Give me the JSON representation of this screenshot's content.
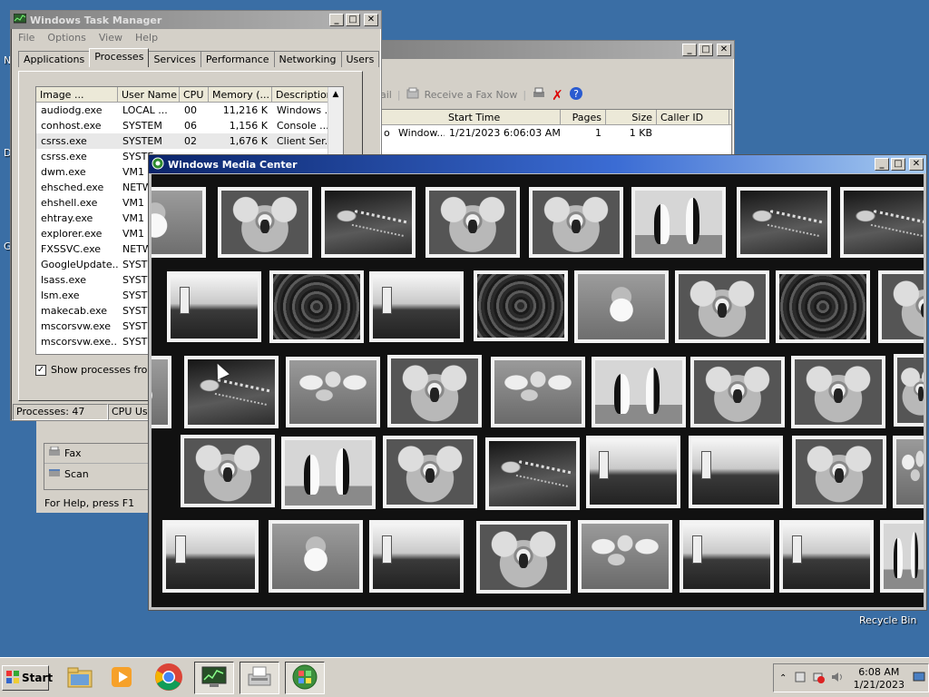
{
  "desktop": {
    "recycle_bin": "Recycle Bin",
    "edge_letters": [
      "N",
      "D",
      "G"
    ]
  },
  "task_manager": {
    "title": "Windows Task Manager",
    "menu": [
      "File",
      "Options",
      "View",
      "Help"
    ],
    "tabs": [
      "Applications",
      "Processes",
      "Services",
      "Performance",
      "Networking",
      "Users"
    ],
    "selected_tab": "Processes",
    "columns": [
      "Image ...",
      "User Name",
      "CPU",
      "Memory (...",
      "Description"
    ],
    "rows": [
      [
        "audiodg.exe",
        "LOCAL ...",
        "00",
        "11,216 K",
        "Windows ..."
      ],
      [
        "conhost.exe",
        "SYSTEM",
        "06",
        "1,156 K",
        "Console ..."
      ],
      [
        "csrss.exe",
        "SYSTEM",
        "02",
        "1,676 K",
        "Client Ser..."
      ],
      [
        "csrss.exe",
        "SYSTE",
        "",
        "",
        ""
      ],
      [
        "dwm.exe",
        "VM1",
        "",
        "",
        ""
      ],
      [
        "ehsched.exe",
        "NETW",
        "",
        "",
        ""
      ],
      [
        "ehshell.exe",
        "VM1",
        "",
        "",
        ""
      ],
      [
        "ehtray.exe",
        "VM1",
        "",
        "",
        ""
      ],
      [
        "explorer.exe",
        "VM1",
        "",
        "",
        ""
      ],
      [
        "FXSSVC.exe",
        "NETW",
        "",
        "",
        ""
      ],
      [
        "GoogleUpdate...",
        "SYSTE",
        "",
        "",
        ""
      ],
      [
        "lsass.exe",
        "SYSTE",
        "",
        "",
        ""
      ],
      [
        "lsm.exe",
        "SYSTE",
        "",
        "",
        ""
      ],
      [
        "makecab.exe",
        "SYSTE",
        "",
        "",
        ""
      ],
      [
        "mscorsvw.exe",
        "SYSTE",
        "",
        "",
        ""
      ],
      [
        "mscorsvw.exe...",
        "SYSTE",
        "",
        "",
        ""
      ]
    ],
    "show_all_label": "Show processes from a",
    "status_processes": "Processes: 47",
    "status_cpu": "CPU Usa"
  },
  "fax": {
    "toolbar_partial": "ail",
    "receive_label": "Receive a Fax Now",
    "columns": [
      "Start Time",
      "Pages",
      "Size",
      "Caller ID"
    ],
    "row": {
      "name": "Window...",
      "start": "1/21/2023 6:06:03 AM",
      "pages": "1",
      "size": "1 KB",
      "caller": ""
    },
    "prefix": "o",
    "sidebar": [
      "Fax",
      "Scan"
    ],
    "status": "For Help, press F1"
  },
  "media_center": {
    "title": "Windows Media Center",
    "rows": [
      [
        "santa",
        "koala",
        "jelly",
        "koala",
        "koala",
        "peng",
        "jelly",
        "jelly"
      ],
      [
        "light",
        "flower",
        "light",
        "flower",
        "santa",
        "koala",
        "flower",
        "koala"
      ],
      [
        "santa",
        "jelly",
        "tulip",
        "koala",
        "tulip",
        "peng",
        "koala",
        "koala",
        "koala"
      ],
      [
        "koala",
        "peng",
        "koala",
        "jelly",
        "light",
        "light",
        "koala",
        "tulip"
      ],
      [
        "light",
        "santa",
        "light",
        "koala",
        "tulip",
        "light",
        "light",
        "peng"
      ]
    ]
  },
  "taskbar": {
    "start_label": "Start",
    "time": "6:08 AM",
    "date": "1/21/2023",
    "pinned": [
      "explorer-icon",
      "media-player-icon",
      "chrome-icon",
      "task-manager-icon",
      "fax-icon",
      "media-center-icon"
    ]
  }
}
